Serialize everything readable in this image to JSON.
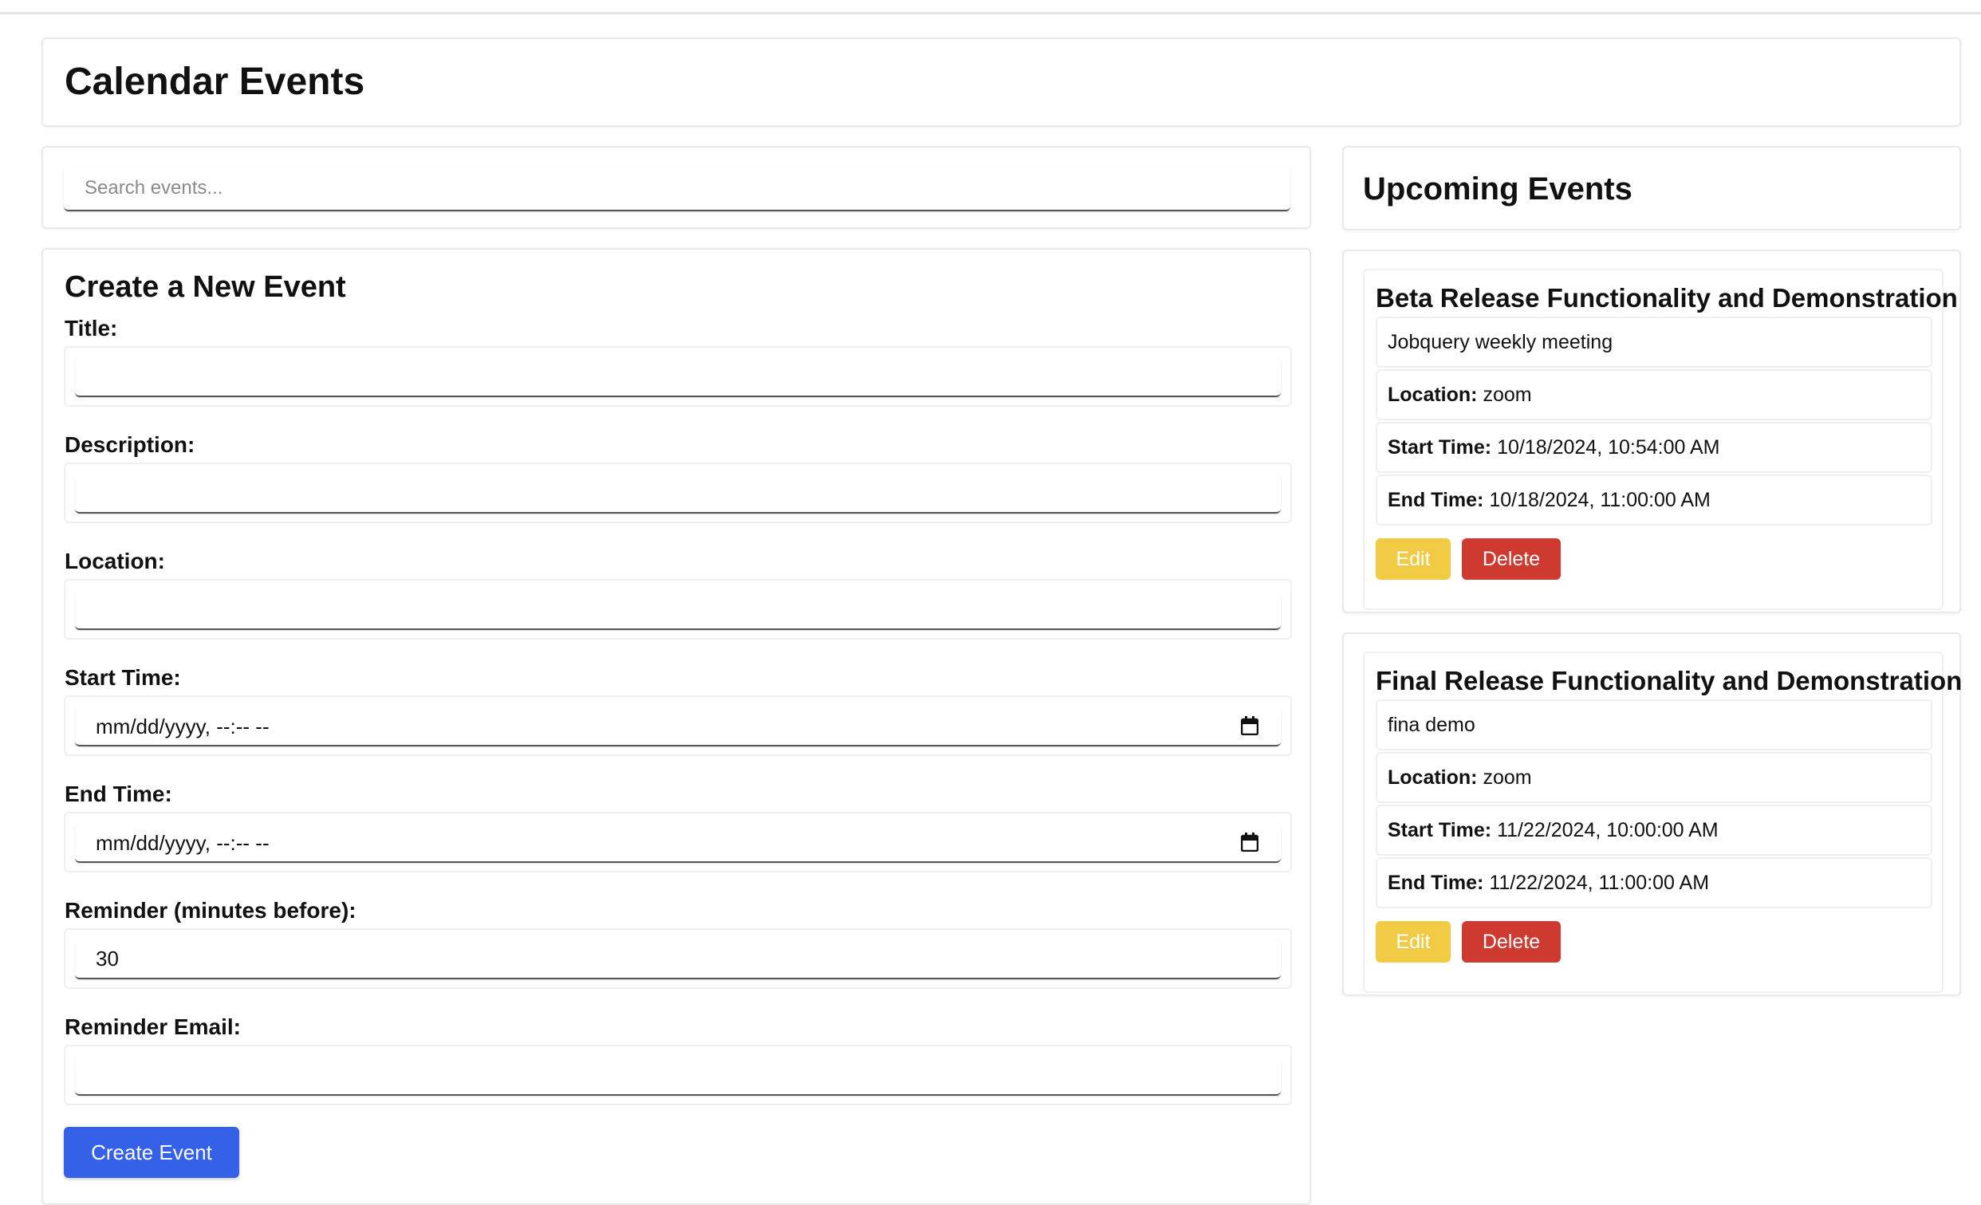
{
  "page": {
    "title": "Calendar Events"
  },
  "search": {
    "placeholder": "Search events..."
  },
  "form": {
    "heading": "Create a New Event",
    "title_label": "Title:",
    "title_value": "",
    "description_label": "Description:",
    "description_value": "",
    "location_label": "Location:",
    "location_value": "",
    "start_label": "Start Time:",
    "start_value": "mm/dd/yyyy, --:-- --",
    "end_label": "End Time:",
    "end_value": "mm/dd/yyyy, --:-- --",
    "reminder_label": "Reminder (minutes before):",
    "reminder_value": "30",
    "email_label": "Reminder Email:",
    "email_value": "",
    "submit_label": "Create Event"
  },
  "upcoming": {
    "heading": "Upcoming Events",
    "location_key": "Location:",
    "start_key": "Start Time:",
    "end_key": "End Time:",
    "edit_label": "Edit",
    "delete_label": "Delete",
    "events": [
      {
        "title": "Beta Release Functionality and Demonstration",
        "description": "Jobquery weekly meeting",
        "location": "zoom",
        "start": "10/18/2024, 10:54:00 AM",
        "end": "10/18/2024, 11:00:00 AM"
      },
      {
        "title": "Final Release Functionality and Demonstration",
        "description": "fina demo",
        "location": "zoom",
        "start": "11/22/2024, 10:00:00 AM",
        "end": "11/22/2024, 11:00:00 AM"
      }
    ]
  },
  "colors": {
    "primary_button": "#3560e8",
    "edit_button": "#f2cb45",
    "delete_button": "#cf3a30"
  },
  "icons": {
    "datetime": "calendar-icon"
  }
}
